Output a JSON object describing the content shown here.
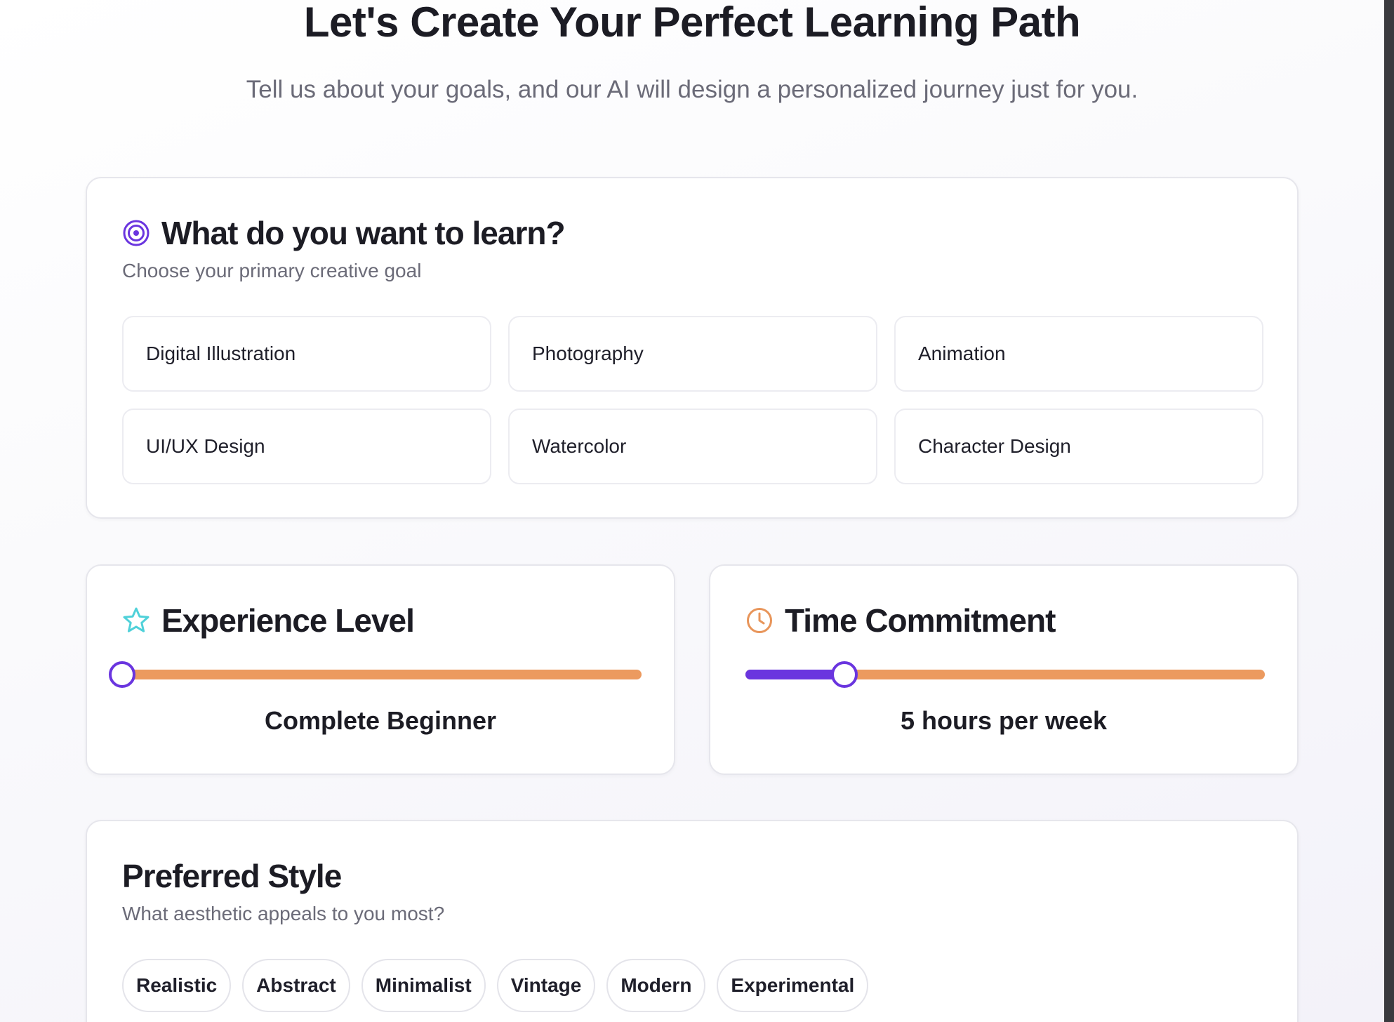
{
  "header": {
    "title": "Let's Create Your Perfect Learning Path",
    "subtitle": "Tell us about your goals, and our AI will design a personalized journey just for you."
  },
  "goal": {
    "icon": "target-icon",
    "title": "What do you want to learn?",
    "description": "Choose your primary creative goal",
    "options": [
      "Digital Illustration",
      "Photography",
      "Animation",
      "UI/UX Design",
      "Watercolor",
      "Character Design"
    ]
  },
  "experience": {
    "icon": "star-icon",
    "title": "Experience Level",
    "slider_fraction": 0.0,
    "value_label": "Complete Beginner"
  },
  "time": {
    "icon": "clock-icon",
    "title": "Time Commitment",
    "slider_fraction": 0.19,
    "value_label": "5 hours per week"
  },
  "style": {
    "title": "Preferred Style",
    "description": "What aesthetic appeals to you most?",
    "options": [
      "Realistic",
      "Abstract",
      "Minimalist",
      "Vintage",
      "Modern",
      "Experimental"
    ]
  },
  "colors": {
    "accent": "#6a35df",
    "track": "#ec9a5f",
    "star": "#4fd1d9",
    "clock": "#e8955a"
  }
}
